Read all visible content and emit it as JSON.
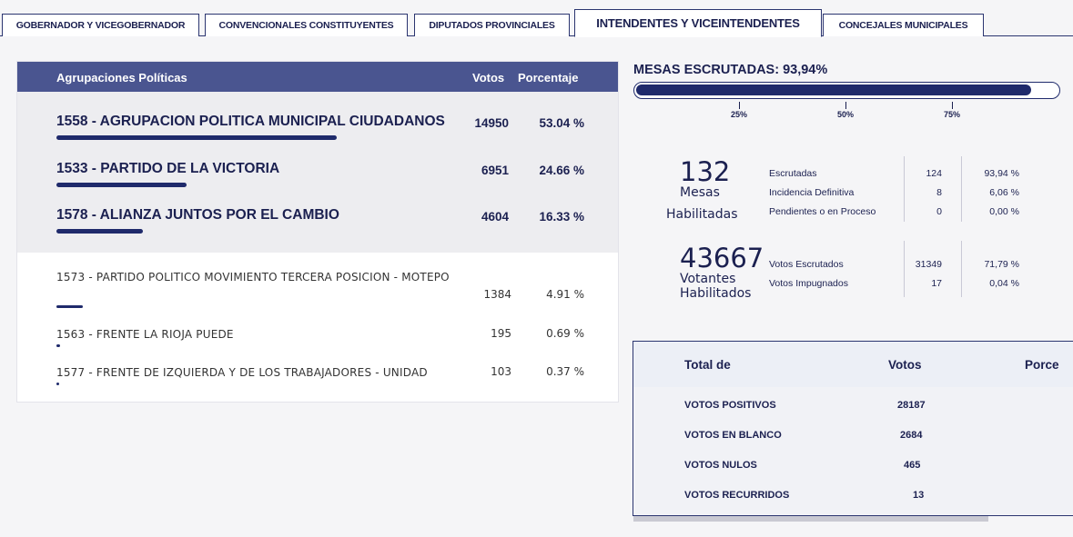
{
  "tabs": [
    {
      "label": "GOBERNADOR Y VICEGOBERNADOR"
    },
    {
      "label": "CONVENCIONALES CONSTITUYENTES"
    },
    {
      "label": "DIPUTADOS PROVINCIALES"
    },
    {
      "label": "INTENDENTES Y VICEINTENDENTES"
    },
    {
      "label": "CONCEJALES MUNICIPALES"
    }
  ],
  "results": {
    "header": {
      "group": "Agrupaciones Políticas",
      "votes": "Votos",
      "pct": "Porcentaje"
    },
    "top": [
      {
        "name": "1558 - AGRUPACION POLITICA MUNICIPAL CIUDADANOS",
        "votes": "14950",
        "pct": "53.04 %",
        "share": 53.04
      },
      {
        "name": "1533 - PARTIDO DE LA VICTORIA",
        "votes": "6951",
        "pct": "24.66 %",
        "share": 24.66
      },
      {
        "name": "1578 - ALIANZA JUNTOS POR EL CAMBIO",
        "votes": "4604",
        "pct": "16.33 %",
        "share": 16.33
      }
    ],
    "others": [
      {
        "name": "1573 - PARTIDO POLITICO MOVIMIENTO TERCERA POSICION - MOTEPO",
        "votes": "1384",
        "pct": "4.91 %",
        "share": 4.91
      },
      {
        "name": "1563 - FRENTE LA RIOJA PUEDE",
        "votes": "195",
        "pct": "0.69 %",
        "share": 0.69
      },
      {
        "name": "1577 - FRENTE DE IZQUIERDA Y DE LOS TRABAJADORES - UNIDAD",
        "votes": "103",
        "pct": "0.37 %",
        "share": 0.37
      }
    ]
  },
  "mesas": {
    "title": "MESAS ESCRUTADAS: 93,94%",
    "progress": 93.94,
    "ticks": [
      "25%",
      "50%",
      "75%"
    ]
  },
  "mesas_habilitadas": {
    "number": "132",
    "label_1": "Mesas",
    "label_2": "Habilitadas",
    "rows": [
      {
        "label": "Escrutadas",
        "value": "124",
        "pct": "93,94 %"
      },
      {
        "label": "Incidencia Definitiva",
        "value": "8",
        "pct": "6,06 %"
      },
      {
        "label": "Pendientes o en Proceso",
        "value": "0",
        "pct": "0,00 %"
      }
    ]
  },
  "votantes": {
    "number": "43667",
    "label_1": "Votantes",
    "label_2": "Habilitados",
    "rows": [
      {
        "label": "Votos Escrutados",
        "value": "31349",
        "pct": "71,79 %"
      },
      {
        "label": "Votos Impugnados",
        "value": "17",
        "pct": "0,04 %"
      }
    ]
  },
  "totals": {
    "header": {
      "label": "Total de",
      "votes": "Votos",
      "pct": "Porce"
    },
    "rows": [
      {
        "label": "VOTOS POSITIVOS",
        "votes": "28187"
      },
      {
        "label": "VOTOS EN BLANCO",
        "votes": "2684"
      },
      {
        "label": "VOTOS NULOS",
        "votes": "465"
      },
      {
        "label": "VOTOS RECURRIDOS",
        "votes": "13"
      }
    ]
  },
  "colors": {
    "primary": "#1f2a6b",
    "header_bg": "#4a5590"
  }
}
